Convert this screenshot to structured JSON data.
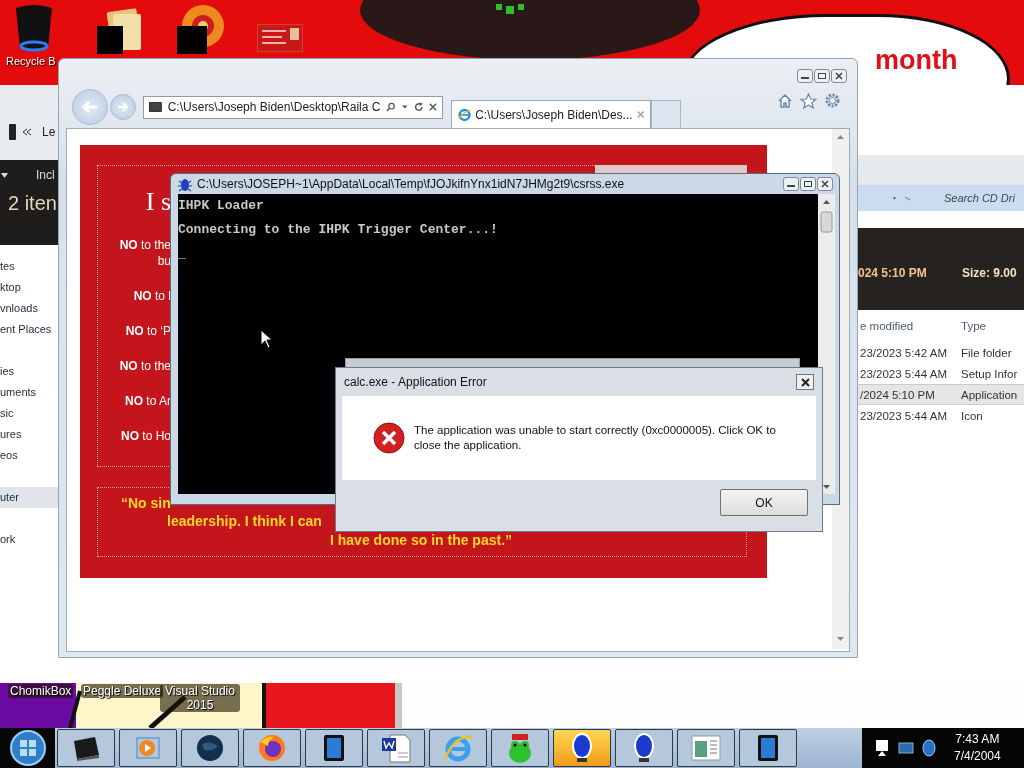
{
  "desktop": {
    "icons": [
      {
        "kind": "recycle-bin",
        "label": "Recycle B"
      },
      {
        "kind": "folder"
      },
      {
        "kind": "disc"
      },
      {
        "kind": "card"
      }
    ],
    "banner": "month",
    "shortcuts": [
      {
        "label": "ChomikBox"
      },
      {
        "label": "Peggle Deluxe"
      },
      {
        "label": "Visual Studio 2015"
      }
    ]
  },
  "explorer": {
    "address": "Le",
    "toolbar_label": "Incl",
    "item_count": "2 iten",
    "nav_groups": [
      [
        {
          "label": "tes",
          "selected": false
        },
        {
          "label": "ktop",
          "selected": false
        },
        {
          "label": "vnloads",
          "selected": false
        },
        {
          "label": "ent Places",
          "selected": false
        }
      ],
      [
        {
          "label": "ies",
          "selected": false
        },
        {
          "label": "uments",
          "selected": false
        },
        {
          "label": "sic",
          "selected": false
        },
        {
          "label": "ures",
          "selected": false
        },
        {
          "label": "eos",
          "selected": false
        }
      ],
      [
        {
          "label": "uter",
          "selected": true
        }
      ],
      [
        {
          "label": "ork",
          "selected": false
        }
      ]
    ],
    "search": {
      "placeholder": "Search CD Dri"
    },
    "details": {
      "date": "024 5:10 PM",
      "size": "Size: 9.00"
    },
    "columns": [
      "e modified",
      "Type"
    ],
    "rows": [
      {
        "modified": "23/2023 5:42 AM",
        "type": "File folder",
        "selected": false
      },
      {
        "modified": "23/2023 5:44 AM",
        "type": "Setup Infor",
        "selected": false
      },
      {
        "modified": "/2024 5:10 PM",
        "type": "Application",
        "selected": true
      },
      {
        "modified": "23/2023 5:44 AM",
        "type": "Icon",
        "selected": false
      }
    ]
  },
  "browser": {
    "address": "C:\\Users\\Joseph Biden\\Desktop\\Raila C",
    "tabs": [
      {
        "title": "C:\\Users\\Joseph Biden\\Des...",
        "selected": true
      }
    ],
    "page": {
      "heading": "I s",
      "items": [
        {
          "lines": [
            "**NO** to the",
            "bu"
          ]
        },
        {
          "lines": [
            "**NO** to l"
          ]
        },
        {
          "lines": [
            "**NO** to ‘P"
          ]
        },
        {
          "lines": [
            "**NO** to the"
          ]
        },
        {
          "lines": [
            "**NO** to Ar"
          ]
        },
        {
          "lines": [
            "**NO** to Ho"
          ]
        }
      ],
      "quote": [
        "“No sin",
        "leadership. I think I can",
        "I have done so in the past.”"
      ]
    }
  },
  "console": {
    "title": "C:\\Users\\JOSEPH~1\\AppData\\Local\\Temp\\fJOJkifnYnx1idN7JHMg2t9\\csrss.exe",
    "lines": [
      "IHPK Loader",
      "Connecting to the IHPK Trigger Center...!",
      "_"
    ]
  },
  "dialog": {
    "title": "calc.exe - Application Error",
    "message": "The application was unable to start correctly (0xc0000005). Click OK to close the application.",
    "button": "OK"
  },
  "taskbar": {
    "buttons": [
      {
        "kind": "device",
        "selected": false
      },
      {
        "kind": "media",
        "selected": false
      },
      {
        "kind": "globe",
        "selected": false
      },
      {
        "kind": "fox",
        "selected": false
      },
      {
        "kind": "tablet",
        "selected": false
      },
      {
        "kind": "word",
        "selected": false
      },
      {
        "kind": "ie",
        "selected": false
      },
      {
        "kind": "frog",
        "selected": false
      },
      {
        "kind": "bulb",
        "selected": true
      },
      {
        "kind": "bulb",
        "selected": false
      },
      {
        "kind": "chart",
        "selected": false
      },
      {
        "kind": "tablet",
        "selected": false
      }
    ],
    "clock": {
      "time": "7:43 AM",
      "date": "7/4/2004"
    }
  }
}
